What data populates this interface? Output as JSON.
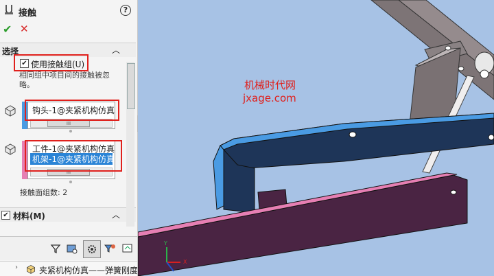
{
  "panel": {
    "title": "接触",
    "help_label": "?",
    "ok_label": "✔",
    "cancel_label": "✕"
  },
  "selection": {
    "section_title": "选择",
    "use_contact_group_label": "使用接触组(U)",
    "use_contact_group_checked": true,
    "hint": "相同组中项目间的接触被忽略。",
    "group1_items": [
      "钩头-1@夹紧机构仿真"
    ],
    "group2_items": [
      "工件-1@夹紧机构仿真",
      "机架-1@夹紧机构仿真"
    ],
    "contact_count_label": "接触面组数: 2"
  },
  "material": {
    "section_title": "材料(M)",
    "checked": true
  },
  "tree": {
    "item_label": "夹紧机构仿真——弹簧刚度"
  },
  "watermark": {
    "line1": "机械时代网",
    "line2": "jxage.com"
  },
  "triad": {
    "x": "X",
    "y": "Y"
  },
  "colors": {
    "viewport_bg": "#a7c2e5",
    "accent_red": "#e0201c",
    "group1_color": "#4a9be3",
    "group2_color": "#e67fb3",
    "arm_color": "#1e3558",
    "base_color": "#4a2443"
  }
}
